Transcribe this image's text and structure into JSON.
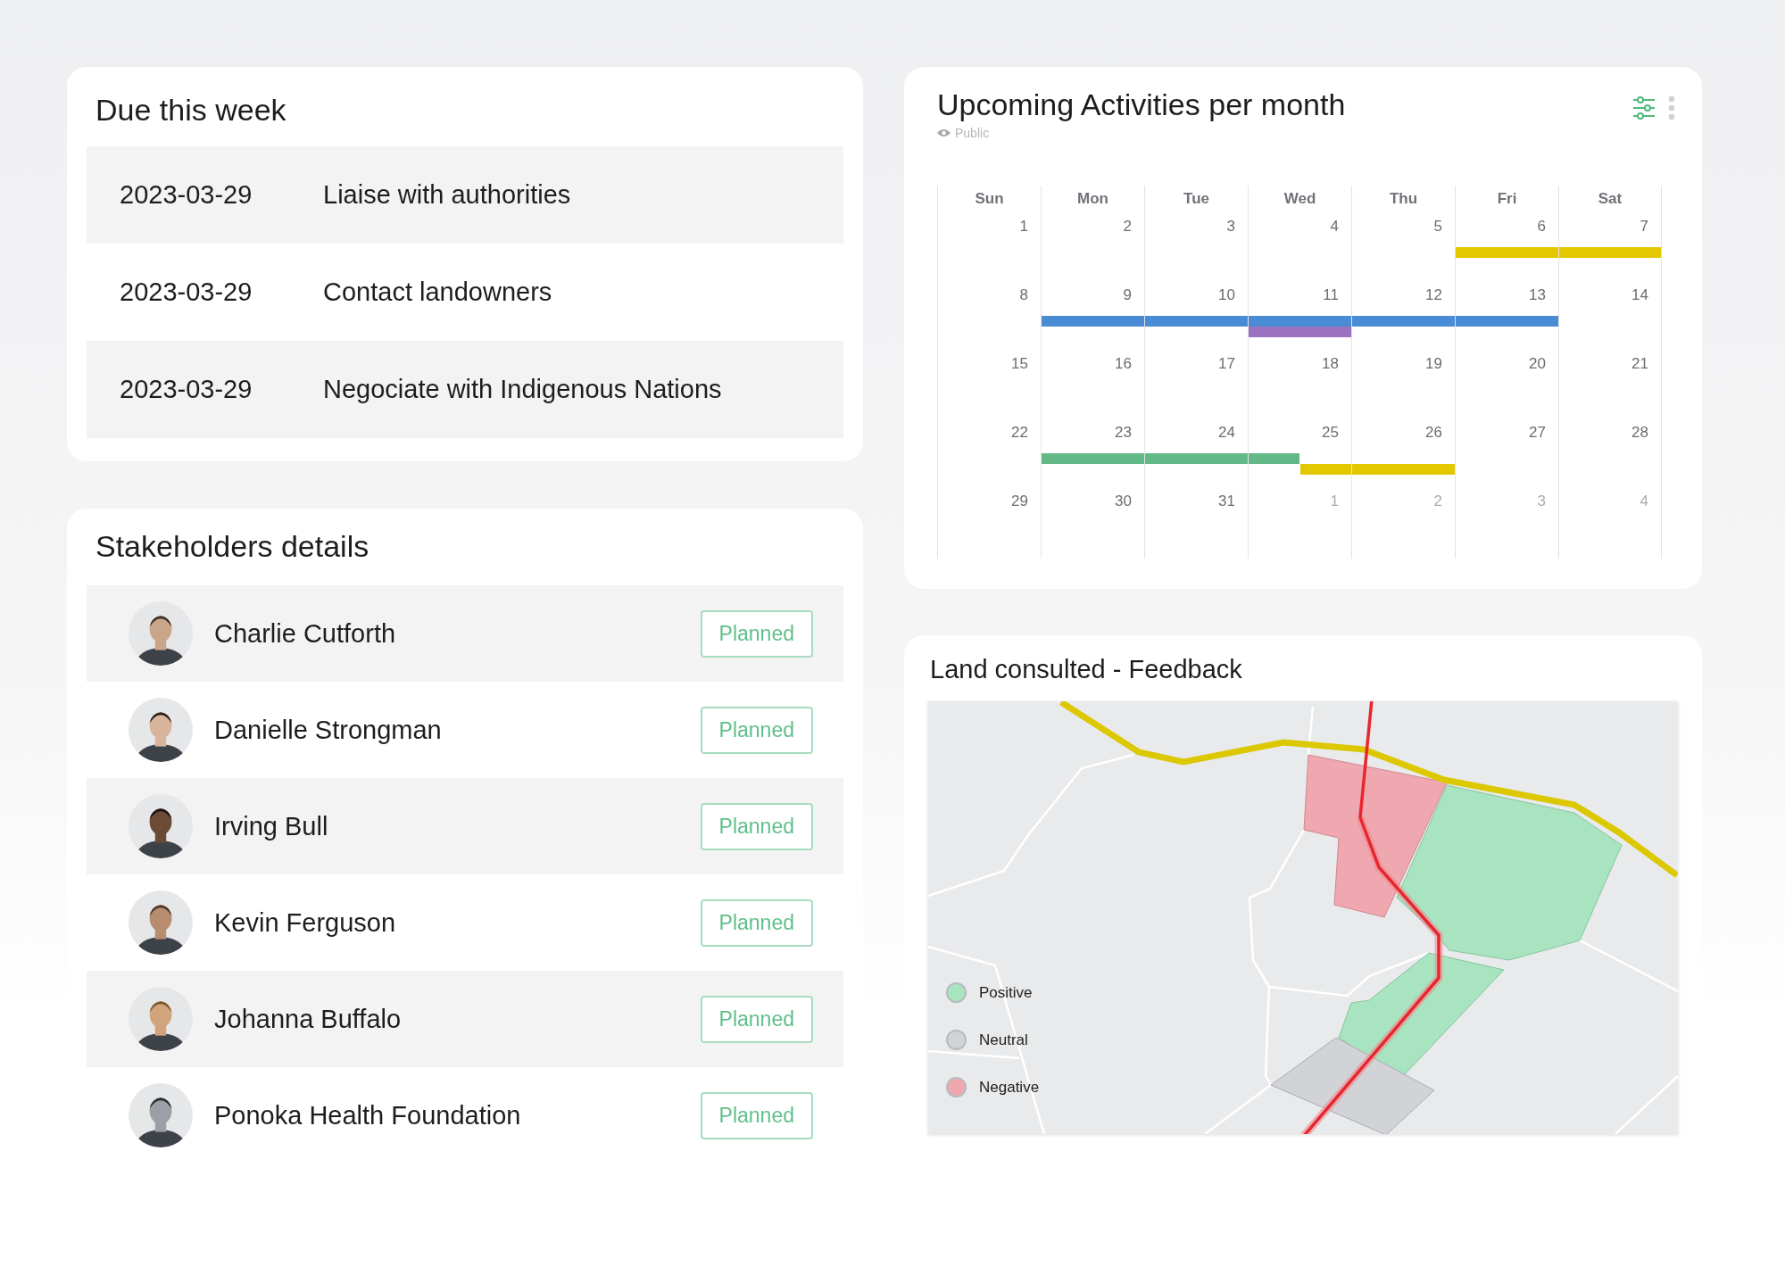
{
  "due_this_week": {
    "title": "Due this week",
    "rows": [
      {
        "date": "2023-03-29",
        "task": "Liaise with authorities"
      },
      {
        "date": "2023-03-29",
        "task": "Contact landowners"
      },
      {
        "date": "2023-03-29",
        "task": "Negociate with Indigenous Nations"
      }
    ]
  },
  "stakeholders": {
    "title": "Stakeholders details",
    "rows": [
      {
        "name": "Charlie Cutforth",
        "status": "Planned"
      },
      {
        "name": "Danielle Strongman",
        "status": "Planned"
      },
      {
        "name": "Irving Bull",
        "status": "Planned"
      },
      {
        "name": "Kevin Ferguson",
        "status": "Planned"
      },
      {
        "name": "Johanna Buffalo",
        "status": "Planned"
      },
      {
        "name": "Ponoka Health Foundation",
        "status": "Planned"
      }
    ]
  },
  "calendar": {
    "title": "Upcoming Activities per month",
    "visibility": "Public",
    "weekdays": [
      "Sun",
      "Mon",
      "Tue",
      "Wed",
      "Thu",
      "Fri",
      "Sat"
    ],
    "weeks": [
      [
        {
          "day": "1",
          "muted": false
        },
        {
          "day": "2",
          "muted": false
        },
        {
          "day": "3",
          "muted": false
        },
        {
          "day": "4",
          "muted": false
        },
        {
          "day": "5",
          "muted": false
        },
        {
          "day": "6",
          "muted": false,
          "events": [
            {
              "color": "#e3c800",
              "kind": "full"
            }
          ]
        },
        {
          "day": "7",
          "muted": false,
          "events": [
            {
              "color": "#e3c800",
              "kind": "full"
            }
          ]
        }
      ],
      [
        {
          "day": "8",
          "muted": false
        },
        {
          "day": "9",
          "muted": false,
          "events": [
            {
              "color": "#4a8bd6",
              "kind": "full"
            }
          ]
        },
        {
          "day": "10",
          "muted": false,
          "events": [
            {
              "color": "#4a8bd6",
              "kind": "full"
            }
          ]
        },
        {
          "day": "11",
          "muted": false,
          "events": [
            {
              "color": "#4a8bd6",
              "kind": "full"
            }
          ],
          "lower_events": [
            {
              "color": "#9c72c0",
              "kind": "full"
            }
          ]
        },
        {
          "day": "12",
          "muted": false,
          "events": [
            {
              "color": "#4a8bd6",
              "kind": "full"
            }
          ]
        },
        {
          "day": "13",
          "muted": false,
          "events": [
            {
              "color": "#4a8bd6",
              "kind": "full"
            }
          ]
        },
        {
          "day": "14",
          "muted": false
        }
      ],
      [
        {
          "day": "15",
          "muted": false
        },
        {
          "day": "16",
          "muted": false
        },
        {
          "day": "17",
          "muted": false
        },
        {
          "day": "18",
          "muted": false
        },
        {
          "day": "19",
          "muted": false
        },
        {
          "day": "20",
          "muted": false
        },
        {
          "day": "21",
          "muted": false
        }
      ],
      [
        {
          "day": "22",
          "muted": false
        },
        {
          "day": "23",
          "muted": false,
          "events": [
            {
              "color": "#62b887",
              "kind": "full"
            }
          ]
        },
        {
          "day": "24",
          "muted": false,
          "events": [
            {
              "color": "#62b887",
              "kind": "full"
            }
          ]
        },
        {
          "day": "25",
          "muted": false,
          "events": [
            {
              "color": "#62b887",
              "kind": "start"
            }
          ],
          "lower_events": [
            {
              "color": "#e3c800",
              "kind": "end"
            }
          ]
        },
        {
          "day": "26",
          "muted": false,
          "lower_events": [
            {
              "color": "#e3c800",
              "kind": "full"
            }
          ]
        },
        {
          "day": "27",
          "muted": false
        },
        {
          "day": "28",
          "muted": false
        }
      ],
      [
        {
          "day": "29",
          "muted": false
        },
        {
          "day": "30",
          "muted": false
        },
        {
          "day": "31",
          "muted": false
        },
        {
          "day": "1",
          "muted": true
        },
        {
          "day": "2",
          "muted": true
        },
        {
          "day": "3",
          "muted": true
        },
        {
          "day": "4",
          "muted": true
        }
      ]
    ]
  },
  "land_feedback": {
    "title": "Land consulted - Feedback",
    "legend": [
      {
        "label": "Positive",
        "color": "#a8e4c0"
      },
      {
        "label": "Neutral",
        "color": "#d2d3d6"
      },
      {
        "label": "Negative",
        "color": "#f0a8b0"
      }
    ]
  }
}
